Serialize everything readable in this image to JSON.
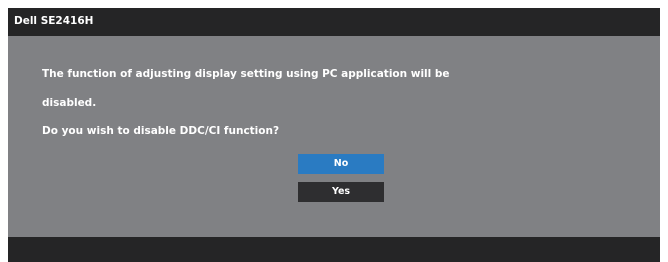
{
  "window": {
    "title": "Dell SE2416H"
  },
  "dialog": {
    "line1": "The function of adjusting display setting using PC application will be",
    "line2": "disabled.",
    "line3": "Do you wish to disable DDC/CI function?"
  },
  "buttons": {
    "no_label": "No",
    "yes_label": "Yes",
    "selected": "No"
  },
  "colors": {
    "panel": "#808184",
    "title_bar": "#252526",
    "selected_button": "#2a7bc2",
    "unselected_button": "#2e2e30",
    "text": "#ffffff"
  }
}
